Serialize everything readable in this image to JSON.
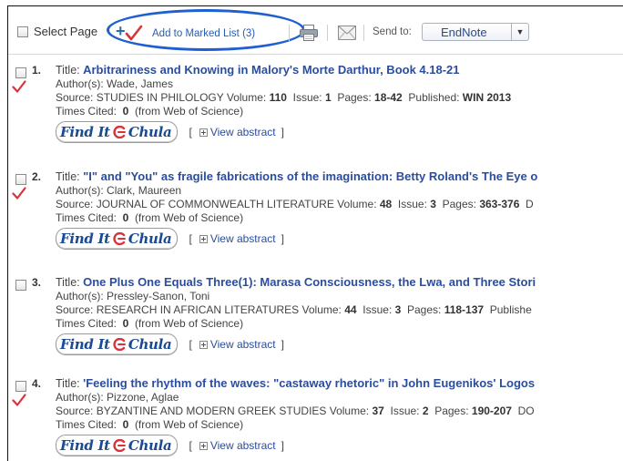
{
  "toolbar": {
    "select_page_label": "Select Page",
    "add_marked_label": "Add to Marked List (3)",
    "send_to_label": "Send to:",
    "send_to_value": "EndNote"
  },
  "common": {
    "title_label": "Title:",
    "authors_label": "Author(s):",
    "source_label": "Source:",
    "volume_label": "Volume:",
    "issue_label": "Issue:",
    "pages_label": "Pages:",
    "published_label": "Published:",
    "times_cited_label": "Times Cited:",
    "from_wos": "(from Web of Science)",
    "view_abstract": "View abstract",
    "bracket_open": "[",
    "bracket_close": "]",
    "findit_a": "Find It",
    "findit_b": "Chula"
  },
  "records": [
    {
      "num": "1.",
      "title": "Arbitrariness and Knowing in Malory's Morte Darthur, Book 4.18-21",
      "authors": "Wade, James",
      "source": "STUDIES IN PHILOLOGY",
      "volume": "110",
      "issue": "1",
      "pages": "18-42",
      "published": "WIN 2013",
      "times_cited": "0",
      "marked": true
    },
    {
      "num": "2.",
      "title": "\"I\" and \"You\" as fragile fabrications of the imagination: Betty Roland's The Eye o",
      "authors": "Clark, Maureen",
      "source": "JOURNAL OF COMMONWEALTH LITERATURE",
      "volume": "48",
      "issue": "3",
      "pages": "363-376",
      "tail": "D",
      "times_cited": "0",
      "marked": true
    },
    {
      "num": "3.",
      "title": "One Plus One Equals Three(1): Marasa Consciousness, the Lwa, and Three Stori",
      "authors": "Pressley-Sanon, Toni",
      "source": "RESEARCH IN AFRICAN LITERATURES",
      "volume": "44",
      "issue": "3",
      "pages": "118-137",
      "tail": "Publishe",
      "times_cited": "0",
      "marked": false
    },
    {
      "num": "4.",
      "title": "'Feeling the rhythm of the waves: \"castaway rhetoric\" in John Eugenikos' Logos",
      "authors": "Pizzone, Aglae",
      "source": "BYZANTINE AND MODERN GREEK STUDIES",
      "volume": "37",
      "issue": "2",
      "pages": "190-207",
      "tail": "DO",
      "times_cited": "0",
      "marked": true
    }
  ],
  "colors": {
    "link": "#2a4da0",
    "highlight_ellipse": "#1f5fd0",
    "marked_check": "#d9333a",
    "findit_text": "#1a4a92",
    "findit_logo": "#d9333a"
  }
}
